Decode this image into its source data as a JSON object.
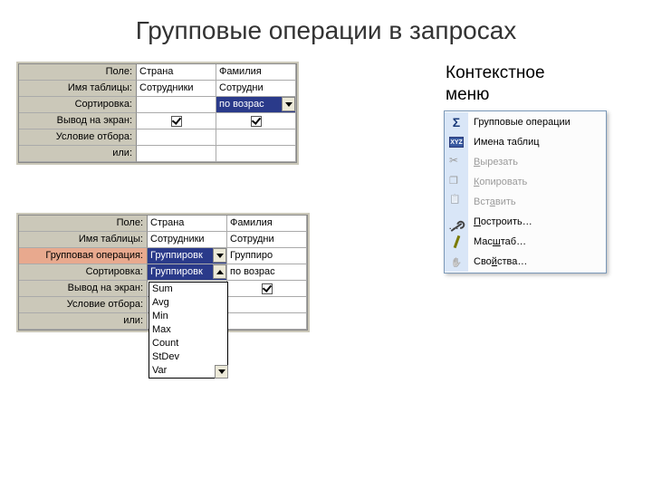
{
  "title": "Групповые операции в запросах",
  "sideLabel1": "Контекстное",
  "sideLabel2": "меню",
  "grid1": {
    "rows": {
      "field": "Поле:",
      "table": "Имя таблицы:",
      "sort": "Сортировка:",
      "show": "Вывод на экран:",
      "crit": "Условие отбора:",
      "or": "или:"
    },
    "c1": {
      "field": "Страна",
      "table": "Сотрудники"
    },
    "c2": {
      "field": "Фамилия",
      "table": "Сотрудни",
      "sort": "по возрас"
    }
  },
  "grid2": {
    "rows": {
      "field": "Поле:",
      "table": "Имя таблицы:",
      "group": "Групповая операция:",
      "sort": "Сортировка:",
      "show": "Вывод на экран:",
      "crit": "Условие отбора:",
      "or": "или:"
    },
    "c1": {
      "field": "Страна",
      "table": "Сотрудники",
      "group": "Группировк",
      "sort": "Группировк"
    },
    "c2": {
      "field": "Фамилия",
      "table": "Сотрудни",
      "group": "Группиро",
      "sort": "по возрас"
    },
    "dropdown": [
      "Sum",
      "Avg",
      "Min",
      "Max",
      "Count",
      "StDev",
      "Var"
    ]
  },
  "ctx": {
    "i0": "Групповые операции",
    "i1": "Имена таблиц",
    "i2a": "В",
    "i2b": "ырезать",
    "i3a": "К",
    "i3b": "опировать",
    "i4a": "Вст",
    "i4b": "а",
    "i4c": "вить",
    "i5a": "П",
    "i5b": "остроить…",
    "i6a": "Мас",
    "i6b": "ш",
    "i6c": "таб…",
    "i7a": "Сво",
    "i7b": "й",
    "i7c": "ства…"
  }
}
